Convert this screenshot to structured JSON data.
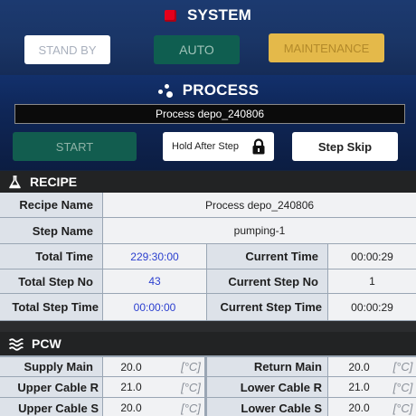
{
  "system": {
    "title": "SYSTEM",
    "buttons": {
      "standby": "STAND BY",
      "auto": "AUTO",
      "maintenance": "MAINTENANCE"
    },
    "icon": "red-square-icon"
  },
  "process": {
    "title": "PROCESS",
    "icon": "dots-icon",
    "recipe_name": "Process depo_240806",
    "buttons": {
      "start": "START",
      "hold_after_step": "Hold After Step",
      "step_skip": "Step Skip"
    }
  },
  "recipe": {
    "title": "RECIPE",
    "labels": {
      "recipe_name": "Recipe Name",
      "step_name": "Step Name",
      "total_time": "Total Time",
      "total_step_no": "Total Step No",
      "total_step_time": "Total Step Time",
      "current_time": "Current Time",
      "current_step_no": "Current Step No",
      "current_step_time": "Current Step Time"
    },
    "values": {
      "recipe_name": "Process depo_240806",
      "step_name": "pumping-1",
      "total_time": "229:30:00",
      "total_step_no": "43",
      "total_step_time": "00:00:00",
      "current_time": "00:00:29",
      "current_step_no": "1",
      "current_step_time": "00:00:29"
    }
  },
  "pcw": {
    "title": "PCW",
    "unit": "[°C]",
    "rows": [
      {
        "left_label": "Supply Main",
        "left_value": "20.0",
        "right_label": "Return Main",
        "right_value": "20.0"
      },
      {
        "left_label": "Upper Cable R",
        "left_value": "21.0",
        "right_label": "Lower Cable R",
        "right_value": "21.0"
      },
      {
        "left_label": "Upper Cable S",
        "left_value": "20.0",
        "right_label": "Lower Cable S",
        "right_value": "20.0"
      }
    ]
  },
  "colors": {
    "accent_green": "#125d4f",
    "maintenance_yellow": "#e4b94a",
    "system_red": "#e4001b",
    "value_blue": "#2b3fcf"
  }
}
